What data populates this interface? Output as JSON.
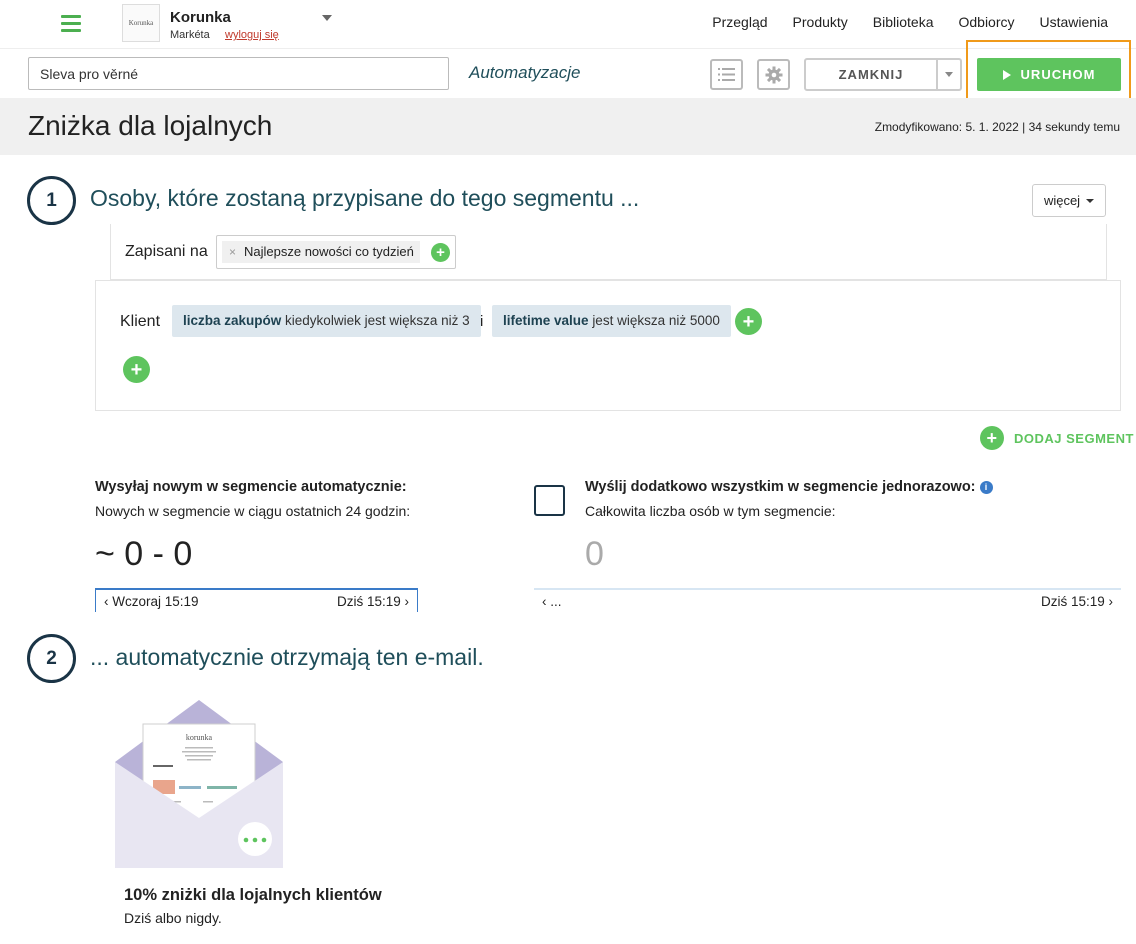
{
  "account": {
    "logo_text": "Korunka",
    "name": "Korunka",
    "user": "Markéta",
    "logout": "wyloguj się"
  },
  "nav": [
    "Przegląd",
    "Produkty",
    "Biblioteka",
    "Odbiorcy",
    "Ustawienia"
  ],
  "toolbar": {
    "name_value": "Sleva pro věrné",
    "breadcrumb": "Automatyzacje",
    "close_label": "ZAMKNIJ",
    "run_label": "URUCHOM"
  },
  "page": {
    "title": "Zniżka dla lojalnych",
    "modified": "Zmodyfikowano: 5. 1. 2022 | 34 sekundy temu"
  },
  "step1": {
    "number": "1",
    "title": "Osoby, które zostaną przypisane do tego segmentu ...",
    "more_label": "więcej",
    "subscribed_label": "Zapisani na",
    "list_tag": "Najlepsze nowości co tydzień",
    "rule_label": "Klient",
    "conditions": [
      {
        "field": "liczba zakupów",
        "text": "kiedykolwiek jest większa niż 3"
      },
      {
        "field": "lifetime value",
        "text": "jest większa niż 5000"
      }
    ],
    "and_label": "i",
    "add_segment_label": "DODAJ SEGMENT"
  },
  "auto_send": {
    "title": "Wysyłaj nowym w segmencie automatycznie:",
    "subtitle": "Nowych w segmencie w ciągu ostatnich 24 godzin:",
    "value": "~ 0 - 0",
    "range_from": "Wczoraj 15:19",
    "range_to": "Dziś 15:19"
  },
  "once_send": {
    "title": "Wyślij dodatkowo wszystkim w segmencie jednorazowo:",
    "subtitle": "Całkowita liczba osób w tym segmencie:",
    "value": "0",
    "range_from": "...",
    "range_to": "Dziś 15:19",
    "checked": false
  },
  "step2": {
    "number": "2",
    "title": "... automatycznie otrzymają ten e-mail."
  },
  "email": {
    "preview_brand": "korunka",
    "title": "10% zniżki dla lojalnych klientów",
    "subtitle": "Dziś albo nigdy."
  },
  "colors": {
    "accent_green": "#5ec45e",
    "highlight_orange": "#f09a1a",
    "heading_teal": "#1f4e5a",
    "envelope": "#e8e6f2"
  }
}
